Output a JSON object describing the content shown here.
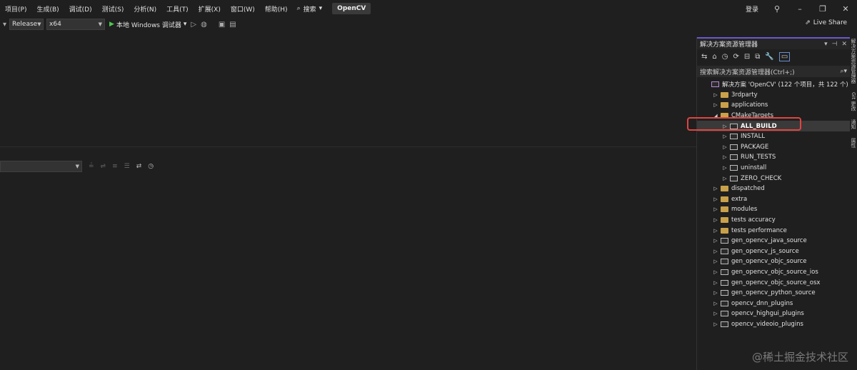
{
  "menubar": {
    "items": [
      "项目(P)",
      "生成(B)",
      "调试(D)",
      "测试(S)",
      "分析(N)",
      "工具(T)",
      "扩展(X)",
      "窗口(W)",
      "帮助(H)"
    ],
    "search_label": "搜索",
    "project_name": "OpenCV",
    "login_label": "登录"
  },
  "toolbar": {
    "config": "Release",
    "platform": "x64",
    "run_label": "本地 Windows 调试器",
    "live_share": "Live Share"
  },
  "solution_explorer": {
    "title": "解决方案资源管理器",
    "search_placeholder": "搜索解决方案资源管理器(Ctrl+;)",
    "tree": [
      {
        "label": "解决方案 'OpenCV' (122 个项目，共 122 个)",
        "depth": 0,
        "kind": "solution",
        "expander": ""
      },
      {
        "label": "3rdparty",
        "depth": 1,
        "kind": "folder",
        "expander": "right"
      },
      {
        "label": "applications",
        "depth": 1,
        "kind": "folder",
        "expander": "right"
      },
      {
        "label": "CMakeTargets",
        "depth": 1,
        "kind": "folder",
        "expander": "down"
      },
      {
        "label": "ALL_BUILD",
        "depth": 2,
        "kind": "project",
        "expander": "right",
        "selected": true
      },
      {
        "label": "INSTALL",
        "depth": 2,
        "kind": "project",
        "expander": "right"
      },
      {
        "label": "PACKAGE",
        "depth": 2,
        "kind": "project",
        "expander": "right"
      },
      {
        "label": "RUN_TESTS",
        "depth": 2,
        "kind": "project",
        "expander": "right"
      },
      {
        "label": "uninstall",
        "depth": 2,
        "kind": "project",
        "expander": "right"
      },
      {
        "label": "ZERO_CHECK",
        "depth": 2,
        "kind": "project",
        "expander": "right"
      },
      {
        "label": "dispatched",
        "depth": 1,
        "kind": "folder",
        "expander": "right"
      },
      {
        "label": "extra",
        "depth": 1,
        "kind": "folder",
        "expander": "right"
      },
      {
        "label": "modules",
        "depth": 1,
        "kind": "folder",
        "expander": "right"
      },
      {
        "label": "tests accuracy",
        "depth": 1,
        "kind": "folder",
        "expander": "right"
      },
      {
        "label": "tests performance",
        "depth": 1,
        "kind": "folder",
        "expander": "right"
      },
      {
        "label": "gen_opencv_java_source",
        "depth": 1,
        "kind": "project",
        "expander": "right"
      },
      {
        "label": "gen_opencv_js_source",
        "depth": 1,
        "kind": "project",
        "expander": "right"
      },
      {
        "label": "gen_opencv_objc_source",
        "depth": 1,
        "kind": "project",
        "expander": "right"
      },
      {
        "label": "gen_opencv_objc_source_ios",
        "depth": 1,
        "kind": "project",
        "expander": "right"
      },
      {
        "label": "gen_opencv_objc_source_osx",
        "depth": 1,
        "kind": "project",
        "expander": "right"
      },
      {
        "label": "gen_opencv_python_source",
        "depth": 1,
        "kind": "project",
        "expander": "right"
      },
      {
        "label": "opencv_dnn_plugins",
        "depth": 1,
        "kind": "project",
        "expander": "right"
      },
      {
        "label": "opencv_highgui_plugins",
        "depth": 1,
        "kind": "project",
        "expander": "right"
      },
      {
        "label": "opencv_videoio_plugins",
        "depth": 1,
        "kind": "project",
        "expander": "right"
      }
    ]
  },
  "side_tabs": [
    "解决方案资源管理器",
    "Git 更改",
    "通知",
    "属性"
  ],
  "watermark": "@稀土掘金技术社区"
}
